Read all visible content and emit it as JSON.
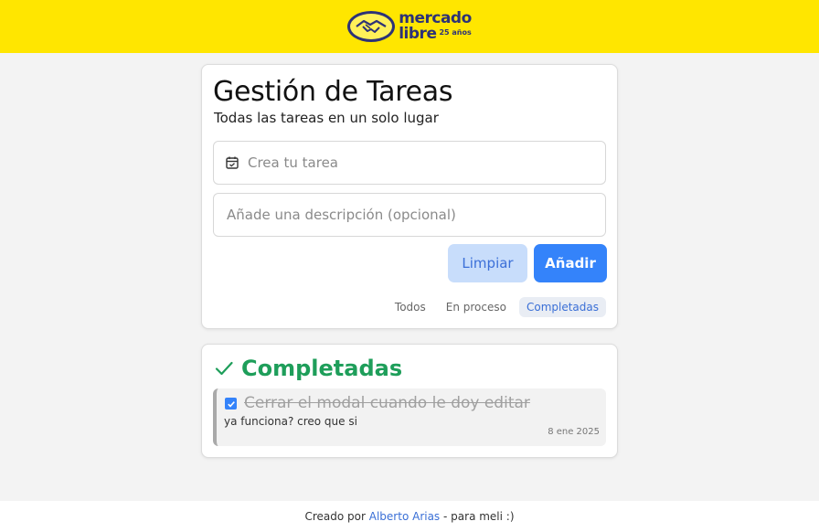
{
  "header": {
    "brand_line1": "mercado",
    "brand_line2": "libre",
    "anniversary": "25 años",
    "brand_color": "#ffe600"
  },
  "main": {
    "title": "Gestión de Tareas",
    "subtitle": "Todas las tareas en un solo lugar",
    "task_input": {
      "placeholder": "Crea tu tarea",
      "value": "",
      "icon": "calendar-check-icon"
    },
    "description_input": {
      "placeholder": "Añade una descripción (opcional)",
      "value": ""
    },
    "buttons": {
      "clear": "Limpiar",
      "add": "Añadir"
    },
    "filters": [
      {
        "label": "Todos",
        "active": false
      },
      {
        "label": "En proceso",
        "active": false
      },
      {
        "label": "Completadas",
        "active": true
      }
    ],
    "accent_color": "#3483fa"
  },
  "completed_section": {
    "title": "Completadas",
    "icon": "checkmark-icon",
    "color": "#1e9e5a",
    "tasks": [
      {
        "title": "Cerrar el modal cuando le doy editar",
        "description": "ya funciona? creo que si",
        "date": "8 ene 2025",
        "checked": true
      }
    ]
  },
  "footer": {
    "prefix": "Creado por",
    "author": "Alberto Arias",
    "suffix": "- para meli :)"
  }
}
